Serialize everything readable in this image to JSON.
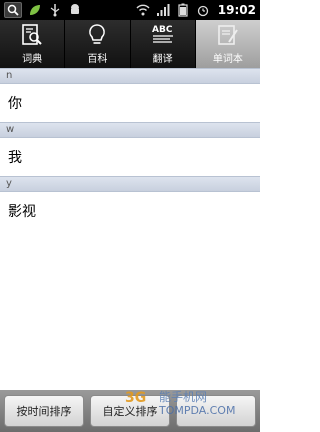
{
  "status_bar": {
    "time": "19:02",
    "left_icons": [
      "search-icon",
      "leaf-icon",
      "usb-icon",
      "android-icon"
    ],
    "right_icons": [
      "wifi-icon",
      "signal-icon",
      "battery-icon",
      "alarm-icon"
    ]
  },
  "tabs": [
    {
      "label": "词典",
      "icon": "dictionary-search-icon",
      "active": false
    },
    {
      "label": "百科",
      "icon": "lightbulb-icon",
      "active": false
    },
    {
      "label": "翻译",
      "icon": "abc-translate-icon",
      "active": false
    },
    {
      "label": "单词本",
      "icon": "notebook-pen-icon",
      "active": true
    }
  ],
  "word_list": [
    {
      "header": "n",
      "word": "你"
    },
    {
      "header": "w",
      "word": "我"
    },
    {
      "header": "y",
      "word": "影视"
    }
  ],
  "bottom_bar": {
    "sort_by_time_label": "按时间排序",
    "middle_label": "自定义排序",
    "right_label": ""
  },
  "watermark": {
    "logo": "3G",
    "title": "能手机网",
    "url": "TOMPDA.COM"
  },
  "colors": {
    "statusbar_bg": "#000000",
    "tab_active_bg": "#b5b5b5",
    "section_header_bg": "#d3d9e5",
    "bottom_bar_bg": "#8a8a8a"
  }
}
